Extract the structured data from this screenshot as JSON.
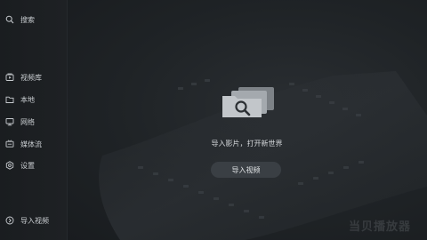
{
  "sidebar": {
    "search": {
      "label": "搜索",
      "icon": "search-icon"
    },
    "items": [
      {
        "label": "视频库",
        "icon": "video-library-icon"
      },
      {
        "label": "本地",
        "icon": "folder-icon"
      },
      {
        "label": "网络",
        "icon": "network-icon"
      },
      {
        "label": "媒体流",
        "icon": "media-stream-icon"
      },
      {
        "label": "设置",
        "icon": "settings-icon"
      }
    ],
    "import": {
      "label": "导入视频",
      "icon": "import-icon"
    }
  },
  "main": {
    "empty_icon": "folder-search-icon",
    "prompt": "导入影片，打开新世界",
    "import_button": "导入视频"
  },
  "watermark": "当贝播放器",
  "colors": {
    "background": "#1c1f22",
    "sidebar": "#1e2124",
    "button": "#3a3f44",
    "text": "#cfd3d6"
  }
}
